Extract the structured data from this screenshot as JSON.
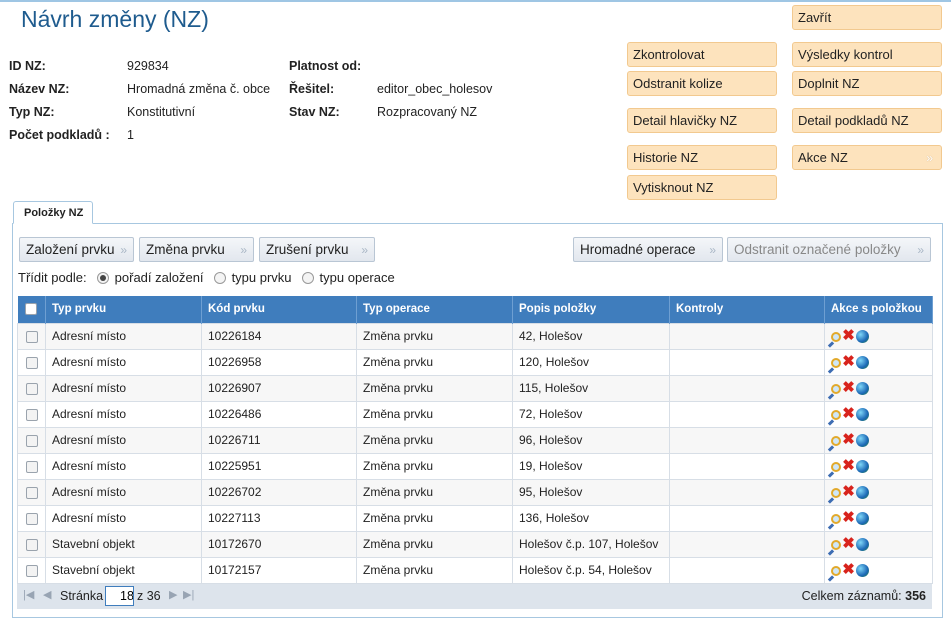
{
  "page": {
    "title": "Návrh změny (NZ)"
  },
  "info": {
    "id_label": "ID NZ:",
    "id_value": "929834",
    "nazev_label": "Název NZ:",
    "nazev_value": "Hromadná změna č. obce",
    "typ_label": "Typ NZ:",
    "typ_value": "Konstitutivní",
    "pocet_label": "Počet podkladů :",
    "pocet_value": "1",
    "platnost_label": "Platnost od:",
    "platnost_value": "",
    "resitel_label": "Řešitel:",
    "resitel_value": "editor_obec_holesov",
    "stav_label": "Stav NZ:",
    "stav_value": "Rozpracovaný NZ"
  },
  "actions": {
    "zavrit": "Zavřít",
    "zkontrolovat": "Zkontrolovat",
    "vysledky": "Výsledky kontrol",
    "odstranit_kolize": "Odstranit kolize",
    "doplnit": "Doplnit NZ",
    "detail_hlavicky": "Detail hlavičky NZ",
    "detail_podkladu": "Detail podkladů NZ",
    "historie": "Historie NZ",
    "akce": "Akce NZ",
    "vytisknout": "Vytisknout NZ"
  },
  "tab": {
    "label": "Položky NZ"
  },
  "toolbar": {
    "zalozeni": "Založení prvku",
    "zmena": "Změna prvku",
    "zruseni": "Zrušení prvku",
    "hromadne": "Hromadné operace",
    "odstranit_oznacene": "Odstranit označené položky"
  },
  "sort": {
    "label": "Třídit podle:",
    "options": [
      "pořadí založení",
      "typu prvku",
      "typu operace"
    ],
    "selected": "pořadí založení"
  },
  "table": {
    "columns": [
      "Typ prvku",
      "Kód prvku",
      "Typ operace",
      "Popis položky",
      "Kontroly",
      "Akce s položkou"
    ],
    "rows": [
      [
        "Adresní místo",
        "10226184",
        "Změna prvku",
        "42, Holešov",
        ""
      ],
      [
        "Adresní místo",
        "10226958",
        "Změna prvku",
        "120, Holešov",
        ""
      ],
      [
        "Adresní místo",
        "10226907",
        "Změna prvku",
        "115, Holešov",
        ""
      ],
      [
        "Adresní místo",
        "10226486",
        "Změna prvku",
        "72, Holešov",
        ""
      ],
      [
        "Adresní místo",
        "10226711",
        "Změna prvku",
        "96, Holešov",
        ""
      ],
      [
        "Adresní místo",
        "10225951",
        "Změna prvku",
        "19, Holešov",
        ""
      ],
      [
        "Adresní místo",
        "10226702",
        "Změna prvku",
        "95, Holešov",
        ""
      ],
      [
        "Adresní místo",
        "10227113",
        "Změna prvku",
        "136, Holešov",
        ""
      ],
      [
        "Stavební objekt",
        "10172670",
        "Změna prvku",
        "Holešov č.p. 107, Holešov",
        ""
      ],
      [
        "Stavební objekt",
        "10172157",
        "Změna prvku",
        "Holešov č.p. 54, Holešov",
        ""
      ]
    ],
    "row_icons": [
      "magnifier-icon",
      "delete-x-icon",
      "globe-icon"
    ]
  },
  "pager": {
    "page_label": "Stránka",
    "page_value": "18",
    "of_label": "z 36",
    "total_label": "Celkem záznamů:",
    "total_value": "356"
  },
  "colors": {
    "title": "#1e5b8e",
    "action_button_bg": "#fde3bd",
    "table_header_bg": "#3f7dbd",
    "pager_bg": "#dde4ec"
  }
}
